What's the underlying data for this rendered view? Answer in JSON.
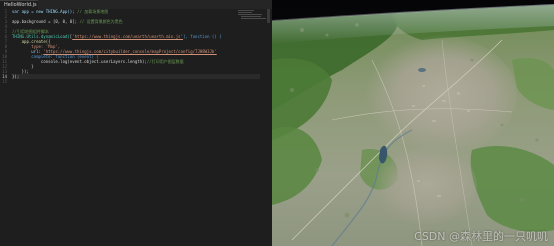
{
  "editor": {
    "tab_label": "HelloWorld.js",
    "line_numbers": [
      "1",
      "2",
      "3",
      "4",
      "5",
      "6",
      "7",
      "8",
      "9",
      "10",
      "11",
      "12",
      "13",
      "14",
      "15"
    ],
    "active_line": "14",
    "code": {
      "l1_decl": "var app = new THING.App();",
      "l1_comment": "// 加载场景地图",
      "l3_code": "app.background = [0, 0, 0];",
      "l3_comment": "// 设置背景颜色为黑色",
      "l5_comment": "//引用地图组件脚本",
      "l6_prefix": "THING.Utils.dynamicLoad(",
      "l6_url": "'https://www.thingjs.com/uearth/uearth.min.js'",
      "l6_suffix": "], function () {",
      "l7_code": "app.create({",
      "l8_code": "type: 'Map',",
      "l9_prefix": "url: ",
      "l9_url": "'https://www.thingjs.com/citybuilder_console/mapProject/config/TJH8W3Jb'",
      "l10_code": "complete: function (event) {",
      "l11_code": "console.log(event.object.userLayers.length);",
      "l11_comment": "//打印用户图层数量",
      "l12_code": "}",
      "l13_code": "});",
      "l14_code": "});"
    }
  },
  "viewer": {
    "watermark": "CSDN @森林里的一只叽叽"
  },
  "colors": {
    "editor_bg": "#1e1e1e",
    "keyword": "#569cd6",
    "string": "#ce9178",
    "comment": "#6a9955",
    "type": "#4ec9b0"
  }
}
